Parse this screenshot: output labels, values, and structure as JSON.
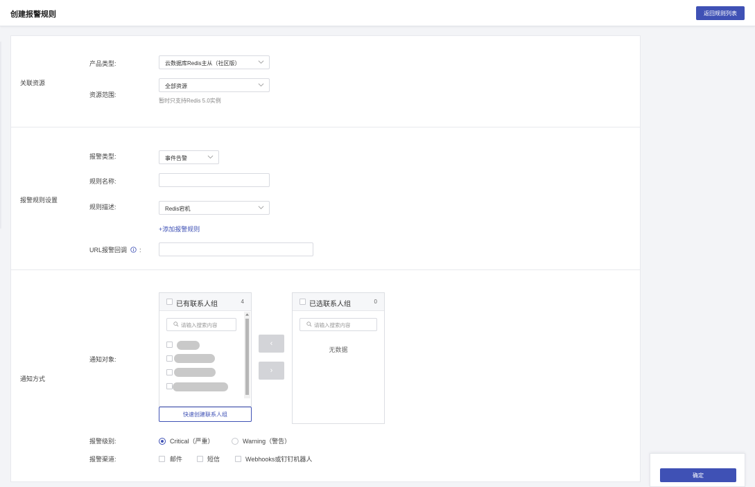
{
  "header": {
    "title": "创建报警规则",
    "back_label": "返回规则列表"
  },
  "related_resources": {
    "section_label": "关联资源",
    "product_type_label": "产品类型:",
    "product_type_value": "云数据库Redis主从（社区版）",
    "resource_scope_label": "资源范围:",
    "resource_scope_value": "全部资源",
    "scope_hint": "暂时只支持Redis 5.0实例"
  },
  "rule_settings": {
    "section_label": "报警规则设置",
    "alarm_type_label": "报警类型:",
    "alarm_type_value": "事件告警",
    "rule_name_label": "规则名称:",
    "rule_name_value": "",
    "rule_desc_label": "规则描述:",
    "rule_desc_value": "Redis宕机",
    "add_rule_link": "+添加报警规则",
    "url_callback_label": "URL报警回调",
    "url_callback_suffix": ":",
    "url_callback_value": ""
  },
  "notify": {
    "section_label": "通知方式",
    "target_label": "通知对象:",
    "available": {
      "title": "已有联系人组",
      "count": "4",
      "search_placeholder": "请输入搜索内容",
      "create_button": "快速创建联系人组"
    },
    "selected": {
      "title": "已选联系人组",
      "count": "0",
      "search_placeholder": "请输入搜索内容",
      "empty_text": "无数据"
    },
    "transfer_left": "‹",
    "transfer_right": "›",
    "level_label": "报警级别:",
    "levels": [
      {
        "label": "Critical（严重）",
        "selected": true
      },
      {
        "label": "Warning（警告）",
        "selected": false
      }
    ],
    "channel_label": "报警渠道:",
    "channels": [
      {
        "label": "邮件",
        "checked": false
      },
      {
        "label": "短信",
        "checked": false
      },
      {
        "label": "Webhooks或钉钉机器人",
        "checked": false
      }
    ]
  },
  "footer": {
    "confirm_label": "确定"
  },
  "colors": {
    "accent": "#3f51b5",
    "border": "#d8dae0",
    "page_bg": "#f3f4f7"
  }
}
